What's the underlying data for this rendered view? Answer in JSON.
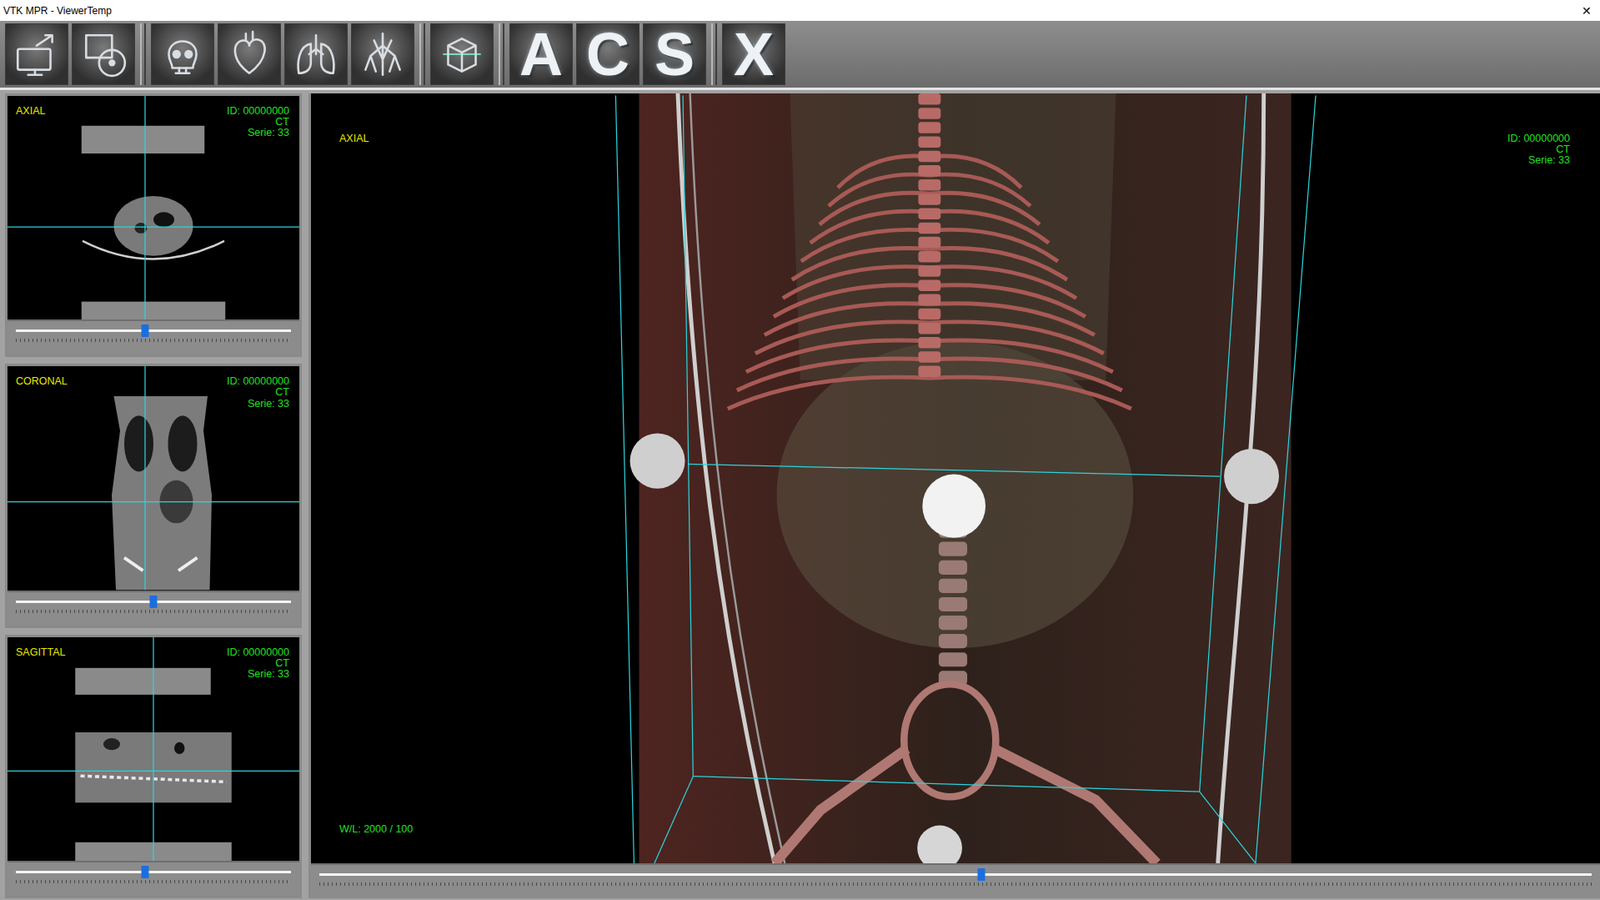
{
  "window": {
    "title": "VTK MPR - ViewerTemp",
    "close": "✕"
  },
  "toolbar": {
    "view_buttons": [
      {
        "label": "A"
      },
      {
        "label": "C"
      },
      {
        "label": "S"
      }
    ],
    "exit_button": {
      "label": "X"
    }
  },
  "views": [
    {
      "kind": "axial",
      "label": "AXIAL",
      "id": "ID: 00000000",
      "modality": "CT",
      "series": "Serie: 33",
      "slider": {
        "level": 0.47
      }
    },
    {
      "kind": "coronal",
      "label": "CORONAL",
      "id": "ID: 00000000",
      "modality": "CT",
      "series": "Serie: 33",
      "slider": {
        "level": 0.5
      }
    },
    {
      "kind": "sagittal",
      "label": "SAGITTAL",
      "id": "ID: 00000000",
      "modality": "CT",
      "series": "Serie: 33",
      "slider": {
        "level": 0.47
      }
    }
  ],
  "main_view": {
    "label": "AXIAL",
    "id": "ID: 00000000",
    "modality": "CT",
    "series": "Serie: 33",
    "window_level": "W/L: 2000 / 100",
    "slider": {
      "level": 0.52
    }
  }
}
